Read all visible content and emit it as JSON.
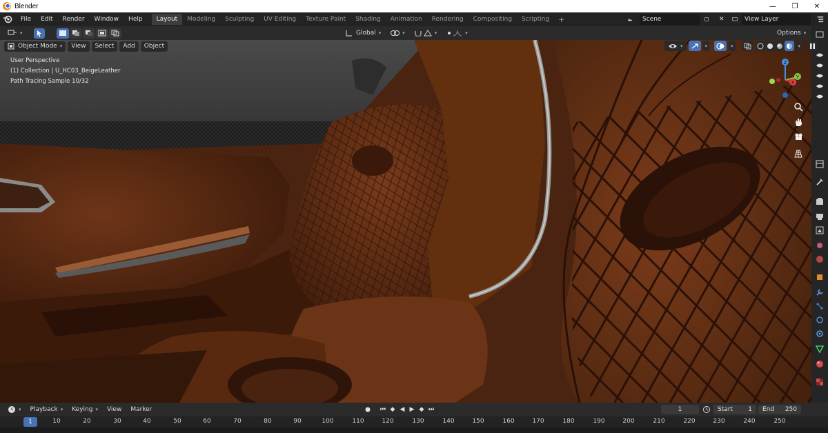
{
  "window": {
    "title": "Blender",
    "controls": [
      "—",
      "❐",
      "✕"
    ]
  },
  "topbar": {
    "menus": [
      "File",
      "Edit",
      "Render",
      "Window",
      "Help"
    ],
    "workspaces": [
      "Layout",
      "Modeling",
      "Sculpting",
      "UV Editing",
      "Texture Paint",
      "Shading",
      "Animation",
      "Rendering",
      "Compositing",
      "Scripting"
    ],
    "active_workspace": "Layout",
    "add_tab": "+",
    "scene": "Scene",
    "view_layer": "View Layer"
  },
  "toolbar": {
    "transform_orientation": "Global",
    "options_label": "Options"
  },
  "viewport_header": {
    "mode": "Object Mode",
    "menus": [
      "View",
      "Select",
      "Add",
      "Object"
    ]
  },
  "viewport": {
    "perspective": "User Perspective",
    "collection": "(1) Collection | U_HC03_BeigeLeather",
    "render_status": "Path Tracing Sample 10/32",
    "gizmo_axes": [
      "Z",
      "Y",
      "X"
    ]
  },
  "timeline": {
    "menus": [
      "Playback",
      "Keying",
      "View",
      "Marker"
    ],
    "current_frame": "1",
    "start_label": "Start",
    "start_value": "1",
    "end_label": "End",
    "end_value": "250",
    "ruler_ticks": [
      "1",
      "10",
      "20",
      "30",
      "40",
      "50",
      "60",
      "70",
      "80",
      "90",
      "100",
      "110",
      "120",
      "130",
      "140",
      "150",
      "160",
      "170",
      "180",
      "190",
      "200",
      "210",
      "220",
      "230",
      "240",
      "250"
    ]
  },
  "colors": {
    "accent": "#4772b3",
    "leather": "#6b3417",
    "leather_dark": "#3a1a0b",
    "x_axis": "#e0433f",
    "y_axis": "#8bc34a",
    "z_axis": "#4a8fe0"
  }
}
